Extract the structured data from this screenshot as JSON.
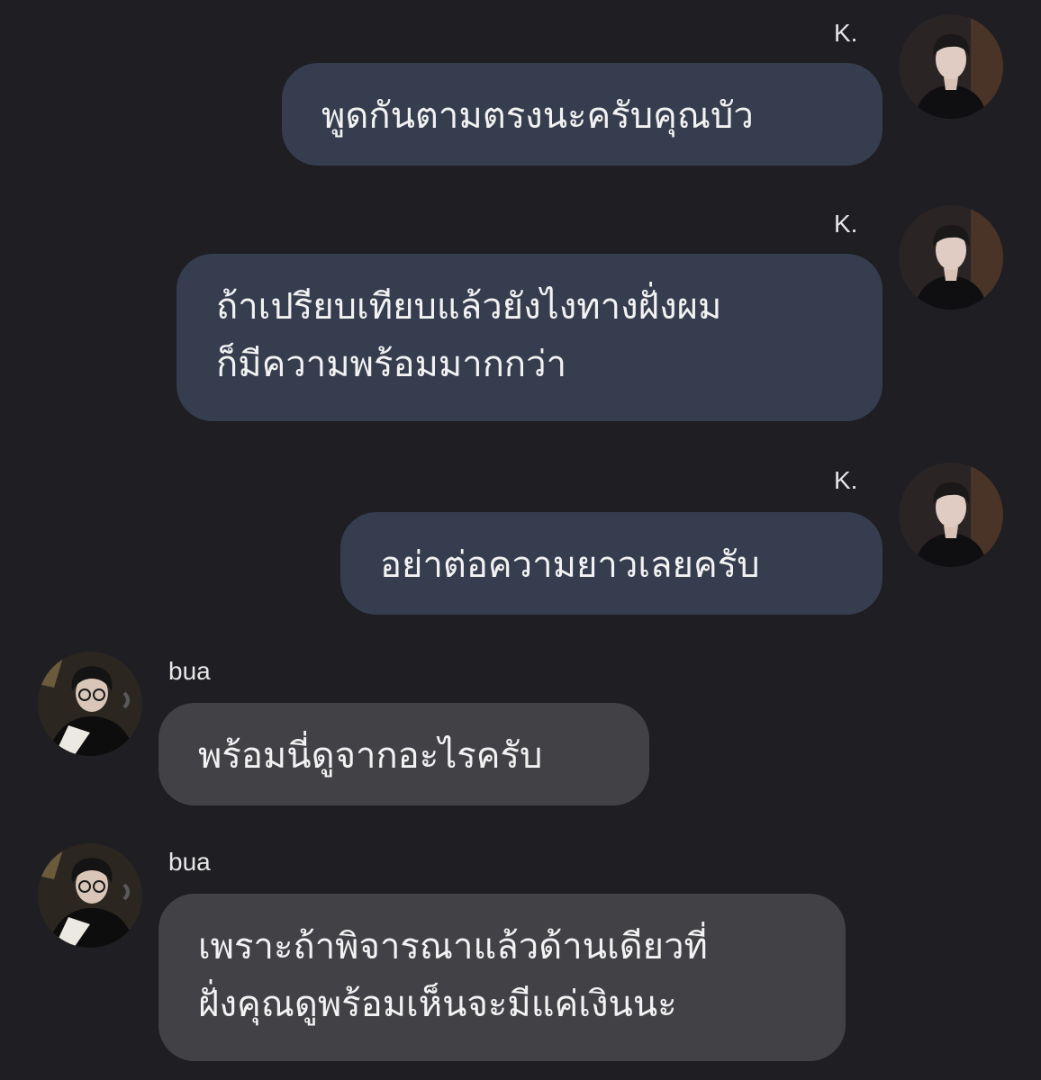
{
  "messages": [
    {
      "sender": "K.",
      "direction": "outgoing",
      "avatar_icon": "user-avatar-icon",
      "text": "พูดกันตามตรงนะครับคุณบัว"
    },
    {
      "sender": "K.",
      "direction": "outgoing",
      "avatar_icon": "user-avatar-icon",
      "text": "ถ้าเปรียบเทียบแล้วยังไงทางฝั่งผม\nก็มีความพร้อมมากกว่า"
    },
    {
      "sender": "K.",
      "direction": "outgoing",
      "avatar_icon": "user-avatar-icon",
      "text": "อย่าต่อความยาวเลยครับ"
    },
    {
      "sender": "bua",
      "direction": "incoming",
      "avatar_icon": "user-avatar-icon",
      "text": "พร้อมนี่ดูจากอะไรครับ"
    },
    {
      "sender": "bua",
      "direction": "incoming",
      "avatar_icon": "user-avatar-icon",
      "text": "เพราะถ้าพิจารณาแล้วด้านเดียวที่\nฝั่งคุณดูพร้อมเห็นจะมีแค่เงินนะ"
    }
  ],
  "colors": {
    "background": "#1e1e23",
    "outgoing_bubble": "#353d4e",
    "incoming_bubble": "#414146",
    "text": "#f2f2f2"
  }
}
